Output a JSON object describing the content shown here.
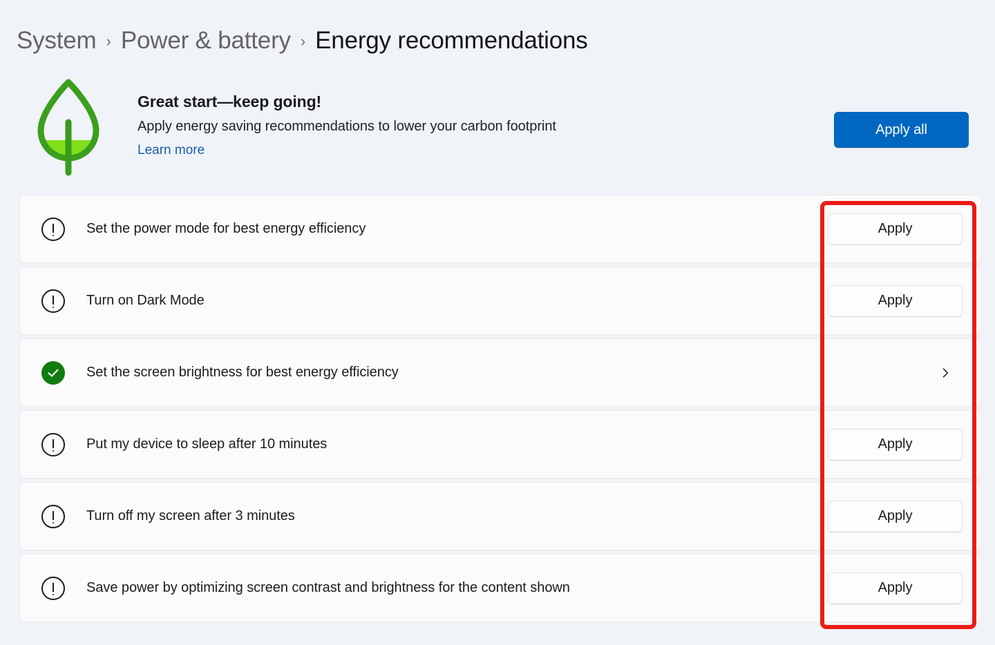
{
  "breadcrumb": {
    "items": [
      {
        "label": "System",
        "current": false
      },
      {
        "label": "Power & battery",
        "current": false
      },
      {
        "label": "Energy recommendations",
        "current": true
      }
    ],
    "separator": "›"
  },
  "hero": {
    "icon": "leaf-icon",
    "title": "Great start—keep going!",
    "subtitle": "Apply energy saving recommendations to lower your carbon footprint",
    "link_label": "Learn more",
    "apply_all_label": "Apply all"
  },
  "recommendations": [
    {
      "label": "Set the power mode for best energy efficiency",
      "status": "pending",
      "status_icon": "warning-icon",
      "action": "apply",
      "action_label": "Apply"
    },
    {
      "label": "Turn on Dark Mode",
      "status": "pending",
      "status_icon": "warning-icon",
      "action": "apply",
      "action_label": "Apply"
    },
    {
      "label": "Set the screen brightness for best energy efficiency",
      "status": "applied",
      "status_icon": "check-circle-icon",
      "action": "chevron",
      "action_label": ""
    },
    {
      "label": "Put my device to sleep after 10 minutes",
      "status": "pending",
      "status_icon": "warning-icon",
      "action": "apply",
      "action_label": "Apply"
    },
    {
      "label": "Turn off my screen after 3 minutes",
      "status": "pending",
      "status_icon": "warning-icon",
      "action": "apply",
      "action_label": "Apply"
    },
    {
      "label": "Save power by optimizing screen contrast and brightness for the content shown",
      "status": "pending",
      "status_icon": "warning-icon",
      "action": "apply",
      "action_label": "Apply"
    }
  ],
  "annotation": {
    "kind": "highlight-box",
    "color": "#EC1C16",
    "targets": "apply-button-column"
  },
  "colors": {
    "page_background": "#F0F3F8",
    "card_background": "#FBFBFB",
    "accent_blue": "#0067C0",
    "link_blue": "#1B5FA8",
    "success_green": "#107C10",
    "leaf_outline_green": "#3C9E1E",
    "leaf_fill_green": "#7FE01A",
    "annotation_red": "#EC1C16"
  }
}
